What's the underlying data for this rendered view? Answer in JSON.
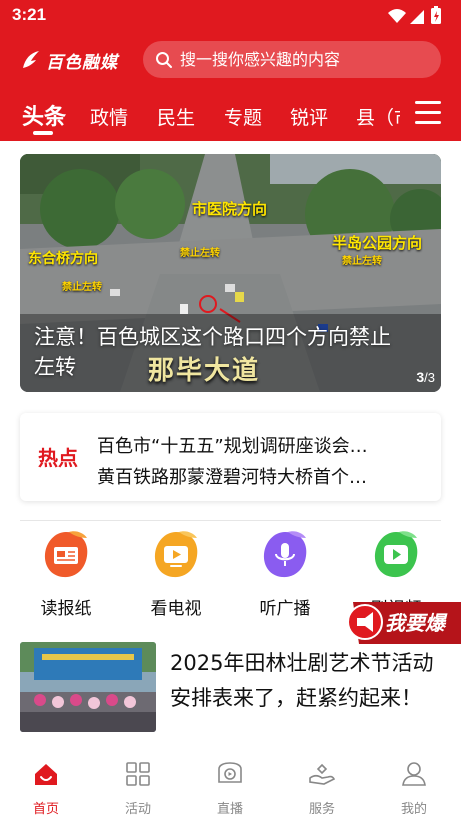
{
  "status": {
    "time": "3:21"
  },
  "header": {
    "logo_text": "百色融媒",
    "search_placeholder": "搜一搜你感兴趣的内容",
    "tabs": [
      {
        "label": "头条",
        "active": true
      },
      {
        "label": "政情"
      },
      {
        "label": "民生"
      },
      {
        "label": "专题"
      },
      {
        "label": "锐评"
      },
      {
        "label": "县（市"
      }
    ],
    "menu_icon": "hamburger-menu-icon",
    "brand_color": "#e0191f"
  },
  "banner": {
    "caption": "注意！百色城区这个路口四个方向禁止左转",
    "labels": {
      "hospital": "市医院方向",
      "bridge": "东合桥方向",
      "park": "半岛公园方向",
      "no_left_1": "禁止左转",
      "no_left_2": "禁止左转",
      "no_left_3": "禁止左转",
      "road": "那毕大道"
    },
    "page_current": "3",
    "page_total": "/3"
  },
  "hot": {
    "label": "热点",
    "items": [
      "百色市“十五五”规划调研座谈会…",
      "黄百铁路那蒙澄碧河特大桥首个…"
    ]
  },
  "services": [
    {
      "label": "读报纸",
      "icon": "newspaper-icon",
      "color": "#f05a2a"
    },
    {
      "label": "看电视",
      "icon": "tv-icon",
      "color": "#f5a623"
    },
    {
      "label": "听广播",
      "icon": "radio-icon",
      "color": "#8a5cf0"
    },
    {
      "label": "刷视频",
      "icon": "video-icon",
      "color": "#3cc44e"
    }
  ],
  "report_button": {
    "label": "我要爆",
    "icon": "megaphone-icon"
  },
  "news": [
    {
      "title": "2025年田林壮剧艺术节活动安排表来了，赶紧约起来！"
    }
  ],
  "bottom_nav": [
    {
      "label": "首页",
      "icon": "home-icon",
      "active": true
    },
    {
      "label": "活动",
      "icon": "grid-icon"
    },
    {
      "label": "直播",
      "icon": "live-icon"
    },
    {
      "label": "服务",
      "icon": "service-hand-icon"
    },
    {
      "label": "我的",
      "icon": "profile-icon"
    }
  ]
}
